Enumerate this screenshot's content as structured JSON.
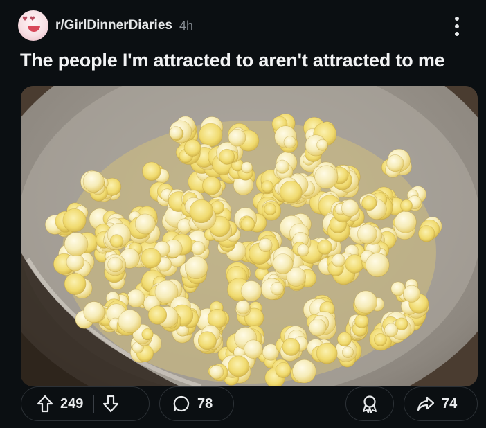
{
  "header": {
    "subreddit": "r/GirlDinnerDiaries",
    "age": "4h",
    "avatar_icon": "subreddit-avatar-icon",
    "overflow_icon": "more-vertical-icon"
  },
  "post": {
    "title": "The people I'm attracted to aren't attracted to me",
    "image_subject": "popcorn-in-bowl-image"
  },
  "actions": {
    "upvote_icon": "arrow-up-icon",
    "score": "249",
    "downvote_icon": "arrow-down-icon",
    "comment_icon": "comment-bubble-icon",
    "comments": "78",
    "award_icon": "award-icon",
    "share_icon": "share-arrow-icon",
    "shares": "74"
  },
  "colors": {
    "background": "#0b0f12",
    "pill_border": "#2c3136",
    "text": "#e8eaec",
    "muted": "#8a9097"
  }
}
